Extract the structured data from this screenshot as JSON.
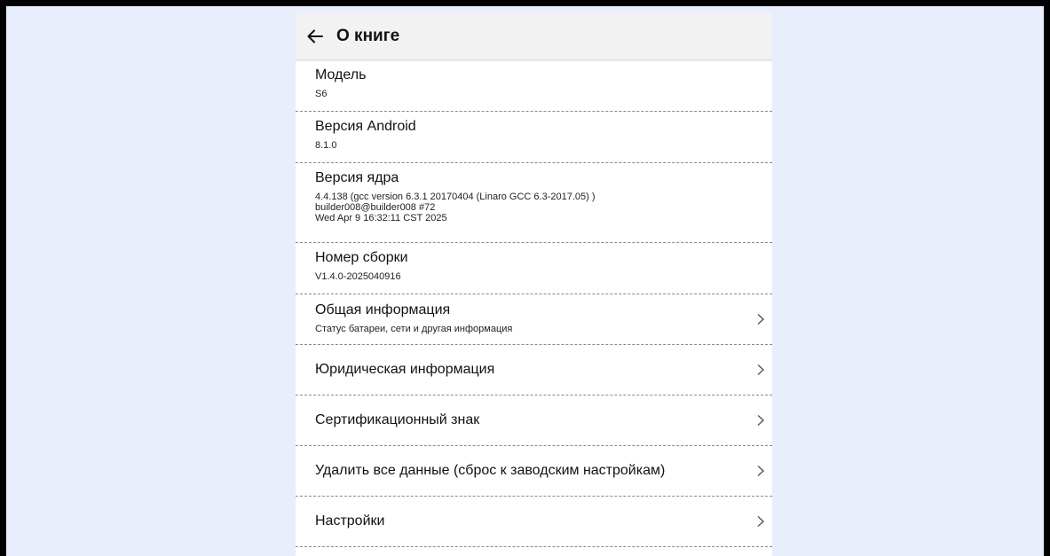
{
  "header": {
    "title": "О книге"
  },
  "info_items": [
    {
      "title": "Модель",
      "value": "S6"
    },
    {
      "title": "Версия Android",
      "value": "8.1.0"
    },
    {
      "title": "Версия ядра",
      "value": "4.4.138 (gcc version 6.3.1 20170404 (Linaro GCC 6.3-2017.05) )\nbuilder008@builder008 #72\nWed Apr 9 16:32:11 CST 2025"
    },
    {
      "title": "Номер сборки",
      "value": "V1.4.0-2025040916"
    }
  ],
  "nav_items": [
    {
      "title": "Общая информация",
      "subtitle": "Статус батареи, сети и другая информация"
    },
    {
      "title": "Юридическая информация"
    },
    {
      "title": "Сертификационный знак"
    },
    {
      "title": "Удалить все данные (сброс к заводским настройкам)"
    },
    {
      "title": "Настройки"
    }
  ],
  "icons": {
    "back": "arrow-left-icon",
    "chevron": "chevron-right-icon"
  },
  "colors": {
    "background": "#e8eefb",
    "appbar": "#f2f2f2",
    "screen": "#ffffff",
    "divider": "#8a8a8a"
  }
}
